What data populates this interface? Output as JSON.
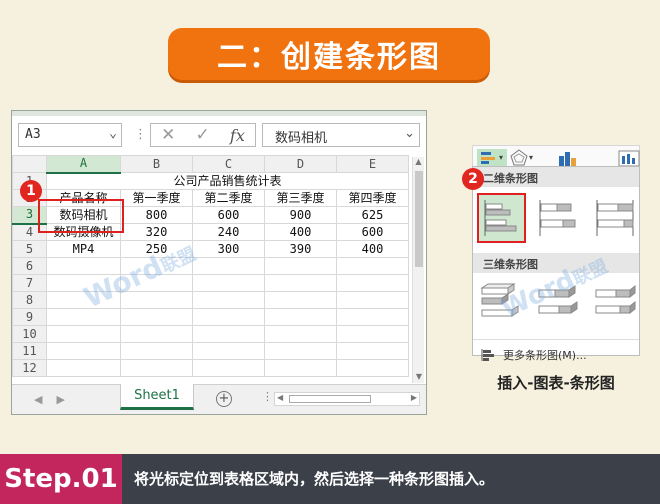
{
  "title": "二：创建条形图",
  "excel": {
    "name_box": "A3",
    "formula_value": "数码相机",
    "fx_label": "fx",
    "columns": [
      "A",
      "B",
      "C",
      "D",
      "E"
    ],
    "rows": [
      {
        "n": "1",
        "cells": [
          "公司产品销售统计表",
          "",
          "",
          "",
          ""
        ]
      },
      {
        "n": "2",
        "cells": [
          "产品名称",
          "第一季度",
          "第二季度",
          "第三季度",
          "第四季度"
        ]
      },
      {
        "n": "3",
        "cells": [
          "数码相机",
          "800",
          "600",
          "900",
          "625"
        ]
      },
      {
        "n": "4",
        "cells": [
          "数码摄像机",
          "320",
          "240",
          "400",
          "600"
        ]
      },
      {
        "n": "5",
        "cells": [
          "MP4",
          "250",
          "300",
          "390",
          "400"
        ]
      },
      {
        "n": "6",
        "cells": [
          "",
          "",
          "",
          "",
          ""
        ]
      },
      {
        "n": "7",
        "cells": [
          "",
          "",
          "",
          "",
          ""
        ]
      },
      {
        "n": "8",
        "cells": [
          "",
          "",
          "",
          "",
          ""
        ]
      },
      {
        "n": "9",
        "cells": [
          "",
          "",
          "",
          "",
          ""
        ]
      },
      {
        "n": "10",
        "cells": [
          "",
          "",
          "",
          "",
          ""
        ]
      },
      {
        "n": "11",
        "cells": [
          "",
          "",
          "",
          "",
          ""
        ]
      },
      {
        "n": "12",
        "cells": [
          "",
          "",
          "",
          "",
          ""
        ]
      }
    ],
    "sheet_tab": "Sheet1"
  },
  "markers": {
    "one": "1",
    "two": "2"
  },
  "chart_panel": {
    "section_2d": "二维条形图",
    "section_3d": "三维条形图",
    "more": "更多条形图(M)..."
  },
  "caption": "插入-图表-条形图",
  "footer": {
    "step": "Step.01",
    "text": "将光标定位到表格区域内，然后选择一种条形图插入。"
  },
  "watermark": {
    "word": "Word",
    "brand": "联盟"
  },
  "colors": {
    "accent": "#f0730f",
    "step": "#c2265c",
    "excel_green": "#1e7145",
    "marker_red": "#e0261f"
  }
}
